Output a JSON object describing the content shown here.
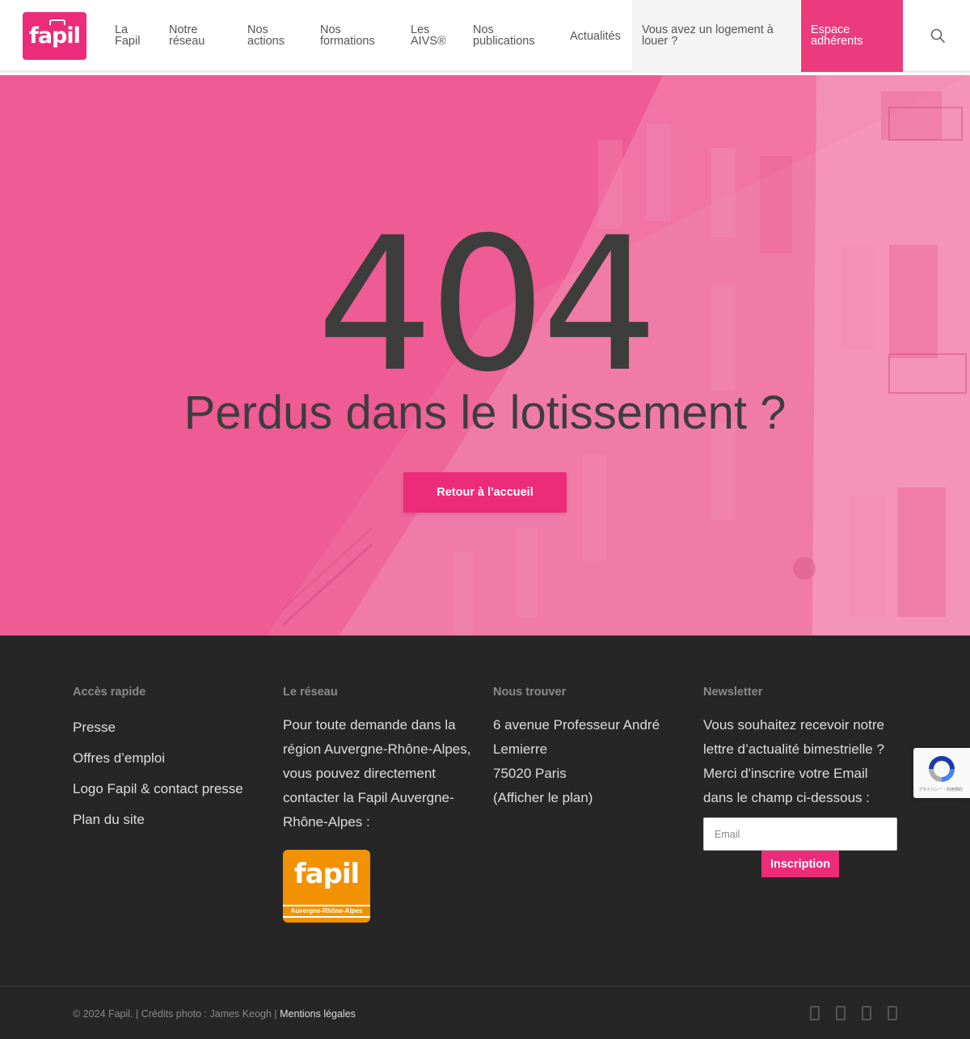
{
  "header": {
    "logo_text": "fapil",
    "nav": [
      {
        "line1": "La",
        "line2": "Fapil"
      },
      {
        "line1": "Notre",
        "line2": "réseau"
      },
      {
        "line1": "Nos",
        "line2": "actions"
      },
      {
        "line1": "Nos",
        "line2": "formations"
      },
      {
        "line1": "Les",
        "line2": "AIVS®"
      },
      {
        "line1": "Nos",
        "line2": "publications"
      },
      {
        "line1": "Actualités"
      }
    ],
    "cta_logement": {
      "line1": "Vous avez un logement à",
      "line2": "louer ?"
    },
    "cta_espace": {
      "line1": "Espace",
      "line2": "adhérents"
    },
    "search_icon": "search-icon"
  },
  "hero": {
    "code": "404",
    "title": "Perdus dans le lotissement ?",
    "button_label": "Retour à l'accueil",
    "overlay_color": "#ef5b93"
  },
  "footer": {
    "quick": {
      "heading": "Accès rapide",
      "links": [
        "Presse",
        "Offres d’emploi",
        "Logo Fapil & contact presse",
        "Plan du site"
      ]
    },
    "network": {
      "heading": "Le réseau",
      "lines": [
        "Pour toute demande dans la",
        "région Auvergne-Rhône-Alpes,",
        "vous pouvez directement",
        "contacter la  Fapil Auvergne-",
        "Rhône-Alpes :"
      ],
      "logo_word": "fapil",
      "logo_band": "Auvergne-Rhône-Alpes"
    },
    "find": {
      "heading": "Nous trouver",
      "lines": [
        "6 avenue Professeur André",
        "Lemierre",
        "75020 Paris",
        "(Afficher le plan)"
      ]
    },
    "newsletter": {
      "heading": "Newsletter",
      "lines": [
        "Vous souhaitez recevoir notre",
        "lettre d’actualité bimestrielle ?",
        "Merci d'inscrire votre Email",
        "dans le champ ci-dessous :"
      ],
      "email_placeholder": "Email",
      "button_label": "Inscription"
    },
    "recaptcha_text": "プライバシー・利用規約"
  },
  "bottom": {
    "copyright": "© 2024 Fapil. | Crédits photo : James Keogh | ",
    "legal_link": "Mentions légales",
    "social_icons": [
      "facebook-icon",
      "twitter-icon",
      "linkedin-icon",
      "youtube-icon"
    ]
  },
  "colors": {
    "brand": "#ec2c78",
    "dark": "#262626",
    "text_dark": "#3d3d3d",
    "aura_orange": "#f39200"
  }
}
